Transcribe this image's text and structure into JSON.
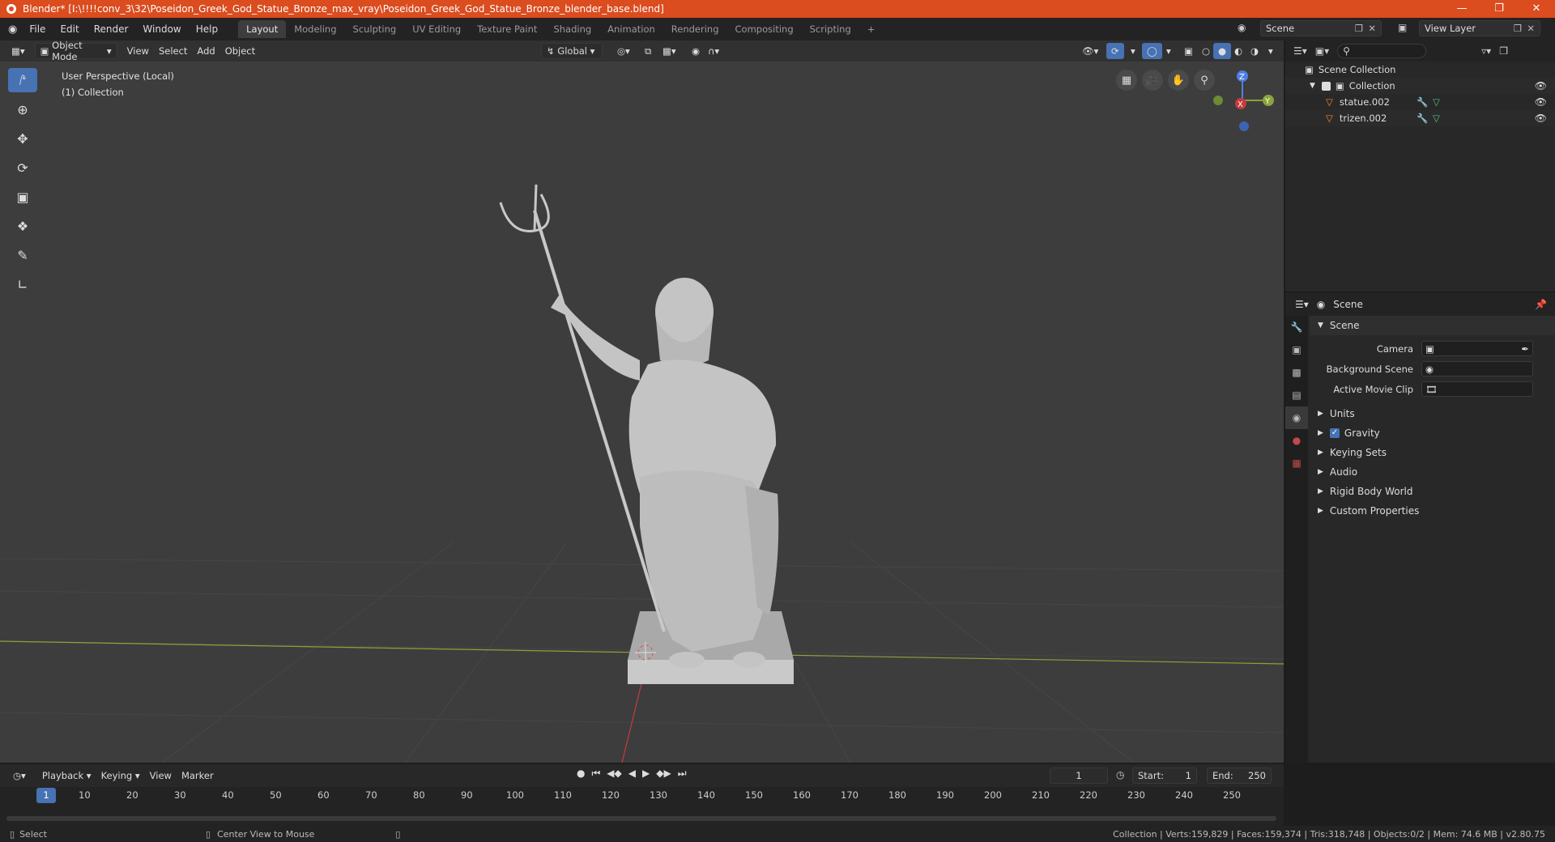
{
  "window": {
    "title": "Blender* [I:\\!!!!conv_3\\32\\Poseidon_Greek_God_Statue_Bronze_max_vray\\Poseidon_Greek_God_Statue_Bronze_blender_base.blend]"
  },
  "menu": [
    "File",
    "Edit",
    "Render",
    "Window",
    "Help"
  ],
  "workspaces": [
    "Layout",
    "Modeling",
    "Sculpting",
    "UV Editing",
    "Texture Paint",
    "Shading",
    "Animation",
    "Rendering",
    "Compositing",
    "Scripting"
  ],
  "scene_selector": "Scene",
  "view_layer": "View Layer",
  "viewport": {
    "mode": "Object Mode",
    "menus": [
      "View",
      "Select",
      "Add",
      "Object"
    ],
    "transform": "Global",
    "info_line1": "User Perspective (Local)",
    "info_line2": "(1) Collection",
    "gizmo": {
      "z": "Z",
      "y": "Y",
      "x": "X"
    },
    "colors": {
      "bg": "#3d3d3d",
      "grid": "#454545",
      "x_axis": "#c43b3b",
      "y_axis": "#8aa43a",
      "accent": "#4772b3"
    }
  },
  "outliner": {
    "root": "Scene Collection",
    "collection": "Collection",
    "items": [
      "statue.002",
      "trizen.002"
    ]
  },
  "properties": {
    "header": "Scene",
    "section": "Scene",
    "fields": [
      {
        "label": "Camera"
      },
      {
        "label": "Background Scene"
      },
      {
        "label": "Active Movie Clip"
      }
    ],
    "subsections": [
      "Units",
      "Gravity",
      "Keying Sets",
      "Audio",
      "Rigid Body World",
      "Custom Properties"
    ]
  },
  "timeline": {
    "menus": [
      "Playback",
      "Keying",
      "View",
      "Marker"
    ],
    "current_frame": "1",
    "start_label": "Start:",
    "start": "1",
    "end_label": "End:",
    "end": "250",
    "ticks": [
      "1",
      "10",
      "20",
      "30",
      "40",
      "50",
      "60",
      "70",
      "80",
      "90",
      "100",
      "110",
      "120",
      "130",
      "140",
      "150",
      "160",
      "170",
      "180",
      "190",
      "200",
      "210",
      "220",
      "230",
      "240",
      "250"
    ]
  },
  "status": {
    "left": "Select",
    "middle": "Center View to Mouse",
    "right": "Collection | Verts:159,829 | Faces:159,374 | Tris:318,748 | Objects:0/2 | Mem: 74.6 MB | v2.80.75"
  }
}
